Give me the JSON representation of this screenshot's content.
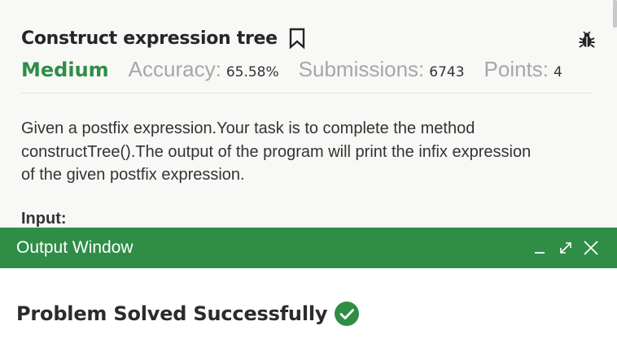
{
  "problem": {
    "title": "Construct expression tree",
    "difficulty": "Medium",
    "accuracy_label": "Accuracy:",
    "accuracy_value": "65.58%",
    "submissions_label": "Submissions:",
    "submissions_value": "6743",
    "points_label": "Points:",
    "points_value": "4",
    "description": "Given a postfix expression.Your task is to complete the method constructTree().The output of the program will print the infix expression of the given postfix expression.",
    "input_heading": "Input:"
  },
  "output_window": {
    "title": "Output Window",
    "status_text": "Problem Solved Successfully"
  },
  "icons": {
    "bookmark": "bookmark-icon",
    "bug": "bug-icon",
    "minimize": "minimize-icon",
    "expand": "expand-icon",
    "close": "close-icon",
    "success": "check-circle-icon"
  },
  "colors": {
    "accent": "#2f8d46",
    "muted": "#a7a7a7",
    "text": "#2a2a2a"
  }
}
